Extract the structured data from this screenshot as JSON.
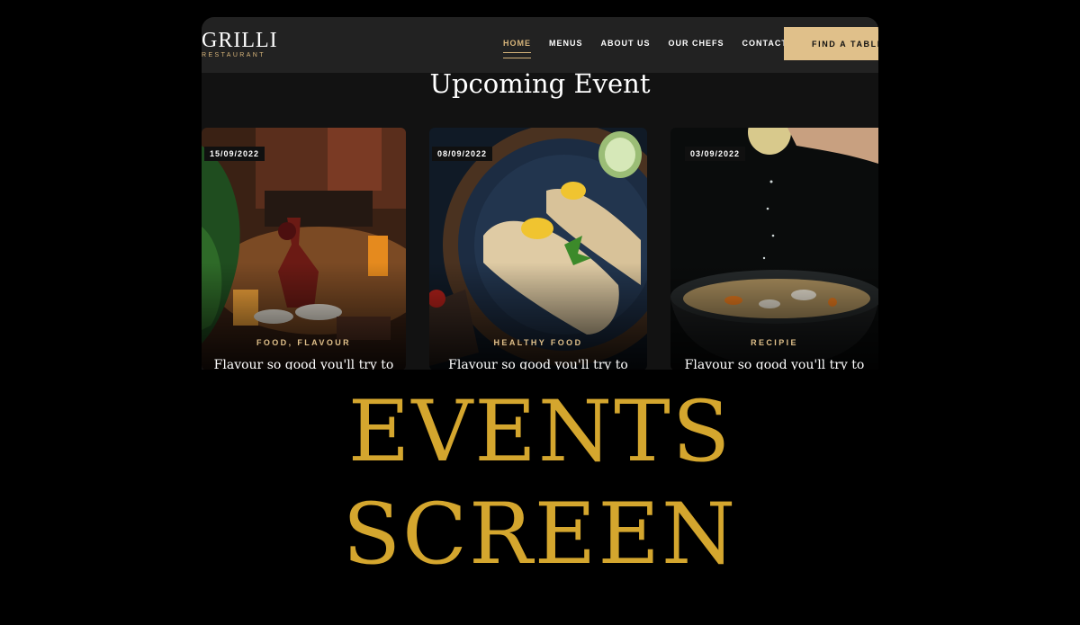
{
  "brand": {
    "name": "GRILLI",
    "tagline": "RESTAURANT"
  },
  "nav": {
    "items": [
      {
        "label": "HOME",
        "active": true
      },
      {
        "label": "MENUS",
        "active": false
      },
      {
        "label": "ABOUT US",
        "active": false
      },
      {
        "label": "OUR CHEFS",
        "active": false
      },
      {
        "label": "CONTACT",
        "active": false
      }
    ],
    "cta_label": "FIND A TABLE"
  },
  "section": {
    "title": "Upcoming Event"
  },
  "events": [
    {
      "date": "15/09/2022",
      "category": "FOOD, FLAVOUR",
      "title": "Flavour so good you'll try to"
    },
    {
      "date": "08/09/2022",
      "category": "HEALTHY FOOD",
      "title": "Flavour so good you'll try to"
    },
    {
      "date": "03/09/2022",
      "category": "RECIPIE",
      "title": "Flavour so good you'll try to"
    }
  ],
  "headline": {
    "line1": "EVENTS",
    "line2": "SCREEN"
  },
  "colors": {
    "accent": "#e0c08a",
    "headline": "#d4a62e",
    "background": "#000000",
    "panel": "#121212",
    "navbar": "#222222"
  }
}
